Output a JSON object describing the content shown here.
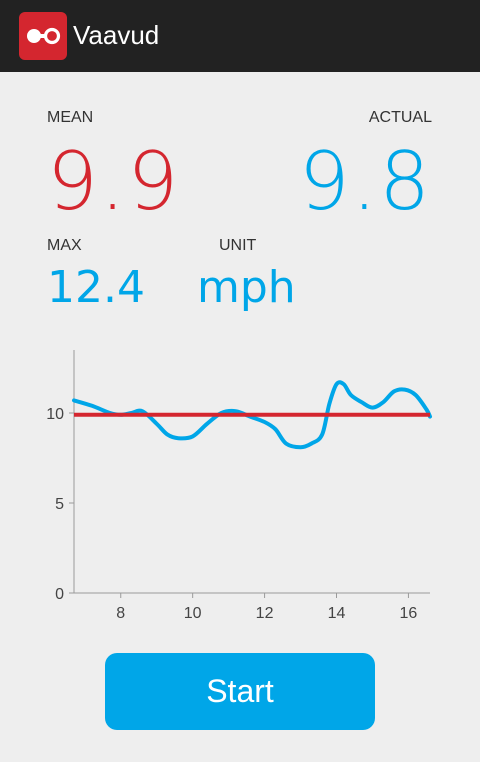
{
  "app": {
    "title": "Vaavud",
    "icon": "vaavud-logo-icon"
  },
  "colors": {
    "red": "#d4262f",
    "blue": "#00a6e8",
    "actionbar": "#222222",
    "background": "#eeeeee"
  },
  "stats": {
    "mean_label": "MEAN",
    "mean_value": "9.9",
    "actual_label": "ACTUAL",
    "actual_value": "9.8",
    "max_label": "MAX",
    "max_value": "12.4",
    "unit_label": "UNIT",
    "unit_value": "mph"
  },
  "chart_data": {
    "type": "line",
    "title": "",
    "xlabel": "",
    "ylabel": "",
    "xlim": [
      6.7,
      16.6
    ],
    "ylim": [
      0,
      13.5
    ],
    "xticks": [
      8,
      10,
      12,
      14,
      16
    ],
    "yticks": [
      0,
      5,
      10
    ],
    "grid": false,
    "series": [
      {
        "color": "#00a6e8",
        "x": [
          6.7,
          7.2,
          7.7,
          8.0,
          8.3,
          8.6,
          9.0,
          9.3,
          9.6,
          10.0,
          10.4,
          10.8,
          11.2,
          11.6,
          12.0,
          12.3,
          12.6,
          13.0,
          13.3,
          13.6,
          13.8,
          14.0,
          14.2,
          14.4,
          14.7,
          15.0,
          15.3,
          15.6,
          15.9,
          16.2,
          16.5,
          16.6
        ],
        "y": [
          10.7,
          10.4,
          10.0,
          9.9,
          10.0,
          10.1,
          9.4,
          8.8,
          8.6,
          8.7,
          9.4,
          10.0,
          10.1,
          9.8,
          9.5,
          9.1,
          8.3,
          8.1,
          8.3,
          8.8,
          10.5,
          11.6,
          11.6,
          11.0,
          10.6,
          10.3,
          10.6,
          11.2,
          11.3,
          11.0,
          10.2,
          9.8
        ]
      },
      {
        "color": "#d4262f",
        "x": [
          6.7,
          16.6
        ],
        "y": [
          9.9,
          9.9
        ]
      }
    ]
  },
  "start_button": {
    "label": "Start"
  }
}
